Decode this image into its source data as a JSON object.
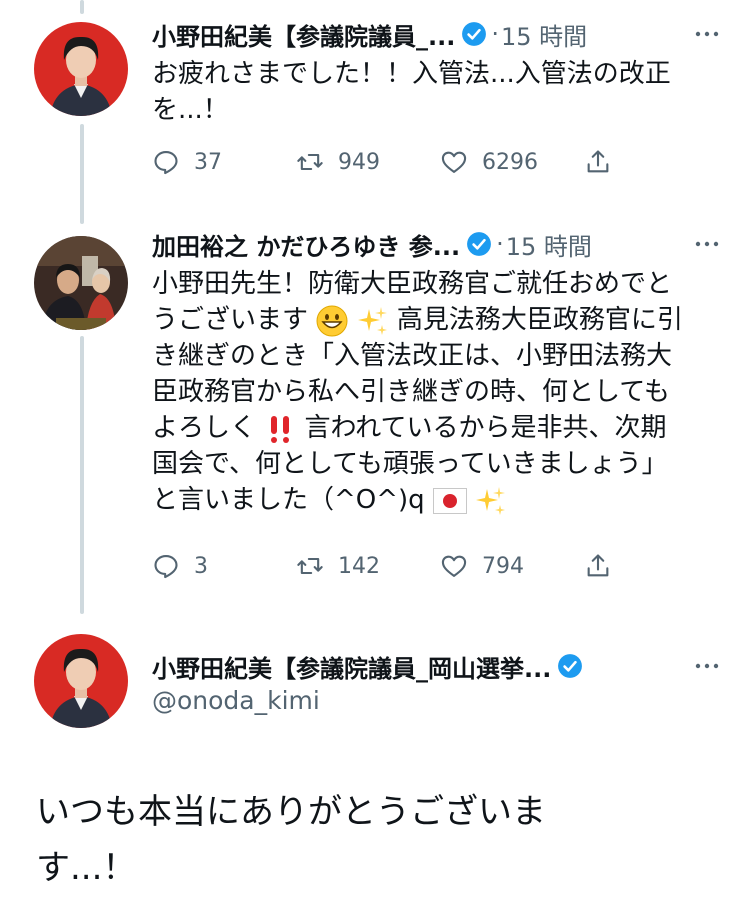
{
  "tweets": [
    {
      "name": "小野田紀美【参議院議員_...",
      "separator": "·",
      "time": "15 時間",
      "text_lines": [
        "お疲れさまでした！！入管法...入管法の改正",
        "を...！"
      ],
      "replies": "37",
      "retweets": "949",
      "likes": "6296"
    },
    {
      "name": "加田裕之 かだひろゆき 参...",
      "separator": "·",
      "time": "15 時間",
      "line1": "小野田先生！防衛大臣政務官ご就任おめでと",
      "line2a": "うございます",
      "line2b": "高見法務大臣政務官に引",
      "line3": "き継ぎのとき「入管法改正は、小野田法務大",
      "line4": "臣政務官から私へ引き継ぎの時、何としても",
      "line5a": "よろしく",
      "line5b": "言われているから是非共、次期",
      "line6": "国会で、何としても頑張っていきましょう」",
      "line7a": "と言いました（^O^)q",
      "replies": "3",
      "retweets": "142",
      "likes": "794"
    }
  ],
  "focused": {
    "name": "小野田紀美【参議院議員_岡山選挙...",
    "handle": "@onoda_kimi",
    "text_lines": [
      "いつも本当にありがとうございま",
      "す...！"
    ]
  },
  "colors": {
    "secondary": "#536471",
    "verified": "#1d9bf0",
    "avatar_bg": "#d82a24",
    "thread_line": "#cfd9de"
  },
  "icons": [
    "reply-icon",
    "retweet-icon",
    "like-icon",
    "share-icon",
    "verified-badge-icon",
    "more-icon",
    "grinning-emoji",
    "sparkles-emoji",
    "double-exclamation-emoji",
    "japan-flag-emoji"
  ]
}
